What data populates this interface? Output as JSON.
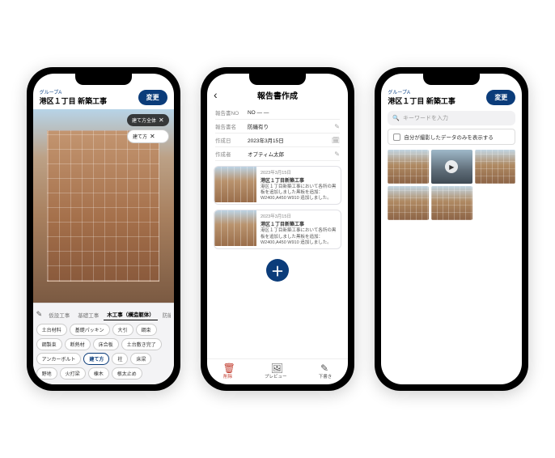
{
  "common": {
    "group_label": "グループA",
    "project_title": "港区１丁目 新築工事",
    "change_btn": "変更"
  },
  "phone1": {
    "overlay": {
      "target": "建て方全体",
      "mode": "建て方",
      "close": "✕"
    },
    "tabs": {
      "t0": "仮設工事",
      "t1": "基礎工事",
      "t2": "木工事（構造躯体）",
      "t3": "防蟻処理"
    },
    "chips": {
      "c0": "土台材料",
      "c1": "基礎パッキン",
      "c2": "大引",
      "c3": "鋼束",
      "c4": "鋼製束",
      "c5": "断熱材",
      "c6": "床合板",
      "c7": "土台敷き完了",
      "c8": "アンカーボルト",
      "c9": "建て方",
      "c10": "柱",
      "c11": "床梁",
      "c12": "野地",
      "c13": "火打梁",
      "c14": "棟木",
      "c15": "根太止め"
    }
  },
  "phone2": {
    "title": "報告書作成",
    "meta": {
      "k_no": "報告書NO",
      "v_no": "NO — —",
      "k_name": "報告書名",
      "v_name": "防蟻有り",
      "k_date": "作成日",
      "v_date": "2023年3月15日",
      "k_author": "作成者",
      "v_author": "オプティム太郎"
    },
    "cards": {
      "date1": "2023年3月15日",
      "title1": "港区１丁目新築工事",
      "text1": "港区１丁目新築工事において各所の黒板を追加しました黒板を追加：W2400,A450 W910 追加しました。",
      "date2": "2023年3月15日",
      "title2": "港区１丁目新築工事",
      "text2": "港区１丁目新築工事において各所の黒板を追加しました黒板を追加：W2400,A450 W910 追加しました。"
    },
    "toolbar": {
      "del": "削除",
      "preview": "プレビュー",
      "draft": "下書き"
    }
  },
  "phone3": {
    "search_placeholder": "キーワードを入力",
    "filter_label": "自分が撮影したデータのみを表示する"
  }
}
